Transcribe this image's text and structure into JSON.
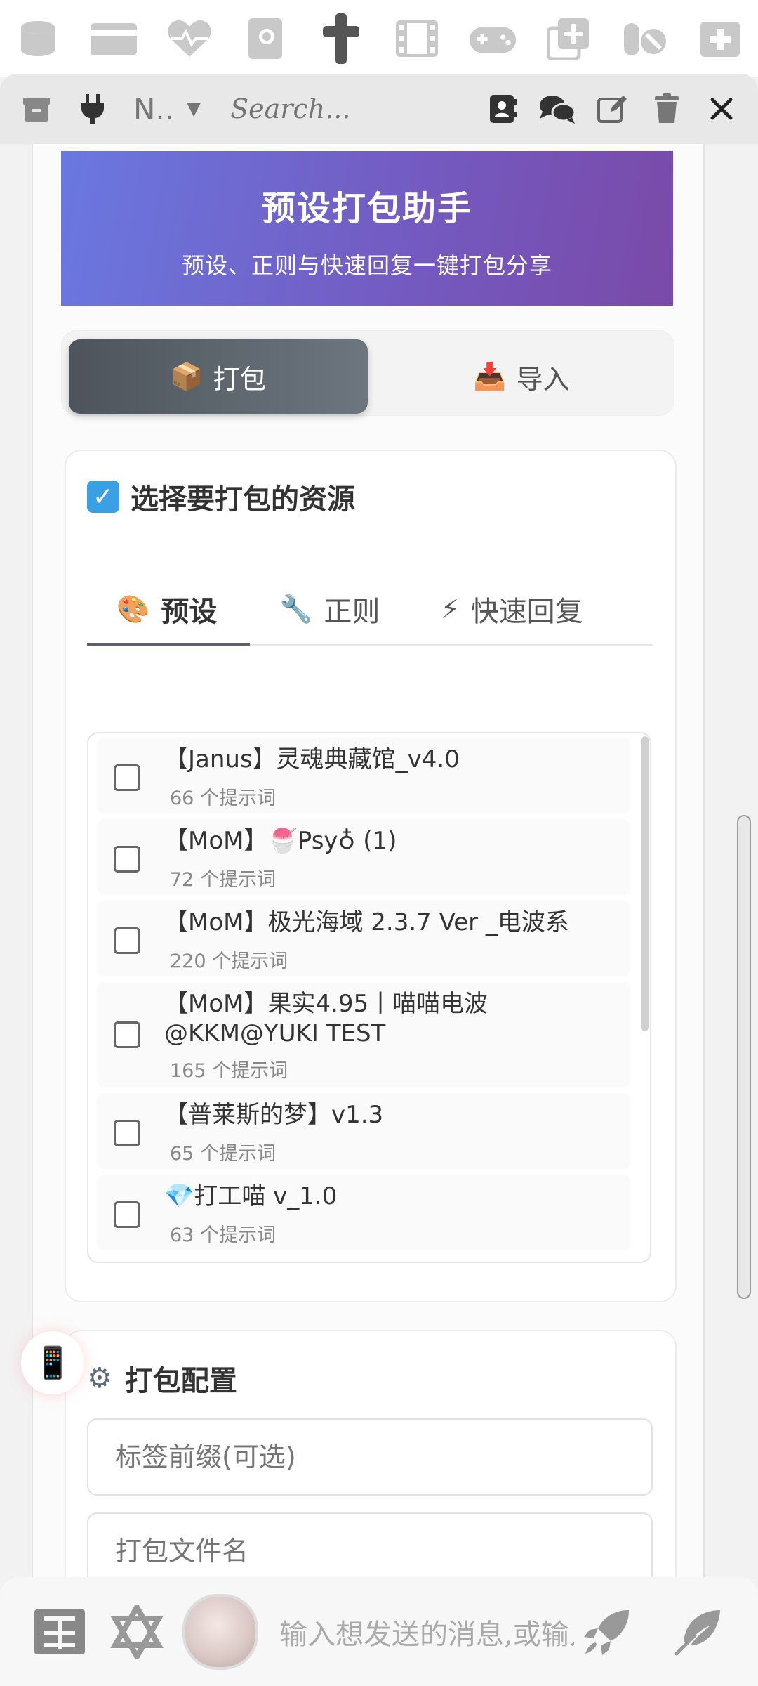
{
  "top_strip": {
    "icons": [
      "database-icon",
      "credit-card-icon",
      "heartbeat-icon",
      "book-icon",
      "cross-icon",
      "film-icon",
      "gamepad-icon",
      "copy-plus-icon",
      "pill-icon",
      "medkit-icon"
    ]
  },
  "toolbar": {
    "select_value": "N..",
    "search_placeholder": "Search..."
  },
  "header": {
    "title": "预设打包助手",
    "subtitle": "预设、正则与快速回复一键打包分享"
  },
  "mode_tabs": [
    {
      "emoji": "📦",
      "label": "打包",
      "active": true
    },
    {
      "emoji": "📥",
      "label": "导入",
      "active": false
    }
  ],
  "select_section": {
    "emoji": "✓",
    "title": "选择要打包的资源",
    "tabs": [
      {
        "emoji": "🎨",
        "label": "预设",
        "active": true
      },
      {
        "emoji": "🔧",
        "label": "正则",
        "active": false
      },
      {
        "emoji": "⚡",
        "label": "快速回复",
        "active": false
      }
    ],
    "items": [
      {
        "title": "【Janus】灵魂典藏馆_v4.0",
        "count": "66 个提示词"
      },
      {
        "title": "【MoM】🍧Psy♁ (1)",
        "count": "72 个提示词"
      },
      {
        "title": "【MoM】极光海域 2.3.7 Ver _电波系",
        "count": "220 个提示词"
      },
      {
        "title": "【MoM】果实4.95丨喵喵电波",
        "title2": "@KKM@YUKI TEST",
        "count": "165 个提示词"
      },
      {
        "title": "【普莱斯的梦】v1.3",
        "count": "65 个提示词"
      },
      {
        "title": "💎打工喵 v_1.0",
        "count": "63 个提示词"
      }
    ]
  },
  "config_section": {
    "title": "打包配置",
    "tag_prefix_placeholder": "标签前缀(可选)",
    "filename_placeholder": "打包文件名"
  },
  "floating": {
    "emoji": "📱"
  },
  "bottom_bar": {
    "message_placeholder": "输入想发送的消息,或输入"
  }
}
